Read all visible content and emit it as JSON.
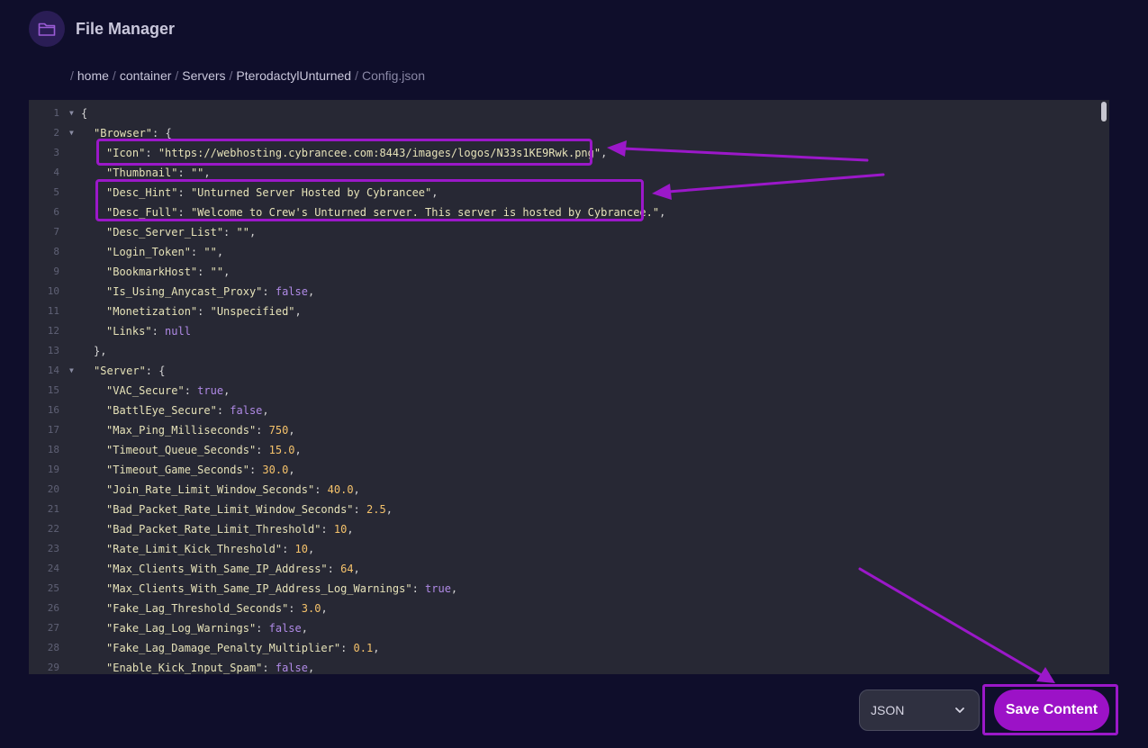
{
  "header": {
    "title": "File Manager",
    "icon": "folder-icon"
  },
  "breadcrumb": {
    "separator": "/",
    "items": [
      "home",
      "container",
      "Servers",
      "PterodactylUnturned"
    ],
    "current": "Config.json"
  },
  "editor": {
    "lines": [
      {
        "n": "1",
        "fold": true,
        "indent": 0,
        "tokens": [
          [
            "p",
            "{"
          ]
        ]
      },
      {
        "n": "2",
        "fold": true,
        "indent": 1,
        "tokens": [
          [
            "k",
            "\"Browser\""
          ],
          [
            "p",
            ": {"
          ]
        ]
      },
      {
        "n": "3",
        "fold": false,
        "indent": 2,
        "tokens": [
          [
            "k",
            "\"Icon\""
          ],
          [
            "p",
            ": "
          ],
          [
            "s",
            "\"https://webhosting.cybrancee.com:8443/images/logos/N33s1KE9Rwk.png\""
          ],
          [
            "p",
            ","
          ]
        ]
      },
      {
        "n": "4",
        "fold": false,
        "indent": 2,
        "tokens": [
          [
            "k",
            "\"Thumbnail\""
          ],
          [
            "p",
            ": "
          ],
          [
            "s",
            "\"\""
          ],
          [
            "p",
            ","
          ]
        ]
      },
      {
        "n": "5",
        "fold": false,
        "indent": 2,
        "tokens": [
          [
            "k",
            "\"Desc_Hint\""
          ],
          [
            "p",
            ": "
          ],
          [
            "s",
            "\"Unturned Server Hosted by Cybrancee\""
          ],
          [
            "p",
            ","
          ]
        ]
      },
      {
        "n": "6",
        "fold": false,
        "indent": 2,
        "tokens": [
          [
            "k",
            "\"Desc_Full\""
          ],
          [
            "p",
            ": "
          ],
          [
            "s",
            "\"Welcome to Crew's Unturned server. This server is hosted by Cybrancee.\""
          ],
          [
            "p",
            ","
          ]
        ]
      },
      {
        "n": "7",
        "fold": false,
        "indent": 2,
        "tokens": [
          [
            "k",
            "\"Desc_Server_List\""
          ],
          [
            "p",
            ": "
          ],
          [
            "s",
            "\"\""
          ],
          [
            "p",
            ","
          ]
        ]
      },
      {
        "n": "8",
        "fold": false,
        "indent": 2,
        "tokens": [
          [
            "k",
            "\"Login_Token\""
          ],
          [
            "p",
            ": "
          ],
          [
            "s",
            "\"\""
          ],
          [
            "p",
            ","
          ]
        ]
      },
      {
        "n": "9",
        "fold": false,
        "indent": 2,
        "tokens": [
          [
            "k",
            "\"BookmarkHost\""
          ],
          [
            "p",
            ": "
          ],
          [
            "s",
            "\"\""
          ],
          [
            "p",
            ","
          ]
        ]
      },
      {
        "n": "10",
        "fold": false,
        "indent": 2,
        "tokens": [
          [
            "k",
            "\"Is_Using_Anycast_Proxy\""
          ],
          [
            "p",
            ": "
          ],
          [
            "b",
            "false"
          ],
          [
            "p",
            ","
          ]
        ]
      },
      {
        "n": "11",
        "fold": false,
        "indent": 2,
        "tokens": [
          [
            "k",
            "\"Monetization\""
          ],
          [
            "p",
            ": "
          ],
          [
            "s",
            "\"Unspecified\""
          ],
          [
            "p",
            ","
          ]
        ]
      },
      {
        "n": "12",
        "fold": false,
        "indent": 2,
        "tokens": [
          [
            "k",
            "\"Links\""
          ],
          [
            "p",
            ": "
          ],
          [
            "b",
            "null"
          ]
        ]
      },
      {
        "n": "13",
        "fold": false,
        "indent": 1,
        "tokens": [
          [
            "p",
            "},"
          ]
        ]
      },
      {
        "n": "14",
        "fold": true,
        "indent": 1,
        "tokens": [
          [
            "k",
            "\"Server\""
          ],
          [
            "p",
            ": {"
          ]
        ]
      },
      {
        "n": "15",
        "fold": false,
        "indent": 2,
        "tokens": [
          [
            "k",
            "\"VAC_Secure\""
          ],
          [
            "p",
            ": "
          ],
          [
            "b",
            "true"
          ],
          [
            "p",
            ","
          ]
        ]
      },
      {
        "n": "16",
        "fold": false,
        "indent": 2,
        "tokens": [
          [
            "k",
            "\"BattlEye_Secure\""
          ],
          [
            "p",
            ": "
          ],
          [
            "b",
            "false"
          ],
          [
            "p",
            ","
          ]
        ]
      },
      {
        "n": "17",
        "fold": false,
        "indent": 2,
        "tokens": [
          [
            "k",
            "\"Max_Ping_Milliseconds\""
          ],
          [
            "p",
            ": "
          ],
          [
            "n",
            "750"
          ],
          [
            "p",
            ","
          ]
        ]
      },
      {
        "n": "18",
        "fold": false,
        "indent": 2,
        "tokens": [
          [
            "k",
            "\"Timeout_Queue_Seconds\""
          ],
          [
            "p",
            ": "
          ],
          [
            "n",
            "15.0"
          ],
          [
            "p",
            ","
          ]
        ]
      },
      {
        "n": "19",
        "fold": false,
        "indent": 2,
        "tokens": [
          [
            "k",
            "\"Timeout_Game_Seconds\""
          ],
          [
            "p",
            ": "
          ],
          [
            "n",
            "30.0"
          ],
          [
            "p",
            ","
          ]
        ]
      },
      {
        "n": "20",
        "fold": false,
        "indent": 2,
        "tokens": [
          [
            "k",
            "\"Join_Rate_Limit_Window_Seconds\""
          ],
          [
            "p",
            ": "
          ],
          [
            "n",
            "40.0"
          ],
          [
            "p",
            ","
          ]
        ]
      },
      {
        "n": "21",
        "fold": false,
        "indent": 2,
        "tokens": [
          [
            "k",
            "\"Bad_Packet_Rate_Limit_Window_Seconds\""
          ],
          [
            "p",
            ": "
          ],
          [
            "n",
            "2.5"
          ],
          [
            "p",
            ","
          ]
        ]
      },
      {
        "n": "22",
        "fold": false,
        "indent": 2,
        "tokens": [
          [
            "k",
            "\"Bad_Packet_Rate_Limit_Threshold\""
          ],
          [
            "p",
            ": "
          ],
          [
            "n",
            "10"
          ],
          [
            "p",
            ","
          ]
        ]
      },
      {
        "n": "23",
        "fold": false,
        "indent": 2,
        "tokens": [
          [
            "k",
            "\"Rate_Limit_Kick_Threshold\""
          ],
          [
            "p",
            ": "
          ],
          [
            "n",
            "10"
          ],
          [
            "p",
            ","
          ]
        ]
      },
      {
        "n": "24",
        "fold": false,
        "indent": 2,
        "tokens": [
          [
            "k",
            "\"Max_Clients_With_Same_IP_Address\""
          ],
          [
            "p",
            ": "
          ],
          [
            "n",
            "64"
          ],
          [
            "p",
            ","
          ]
        ]
      },
      {
        "n": "25",
        "fold": false,
        "indent": 2,
        "tokens": [
          [
            "k",
            "\"Max_Clients_With_Same_IP_Address_Log_Warnings\""
          ],
          [
            "p",
            ": "
          ],
          [
            "b",
            "true"
          ],
          [
            "p",
            ","
          ]
        ]
      },
      {
        "n": "26",
        "fold": false,
        "indent": 2,
        "tokens": [
          [
            "k",
            "\"Fake_Lag_Threshold_Seconds\""
          ],
          [
            "p",
            ": "
          ],
          [
            "n",
            "3.0"
          ],
          [
            "p",
            ","
          ]
        ]
      },
      {
        "n": "27",
        "fold": false,
        "indent": 2,
        "tokens": [
          [
            "k",
            "\"Fake_Lag_Log_Warnings\""
          ],
          [
            "p",
            ": "
          ],
          [
            "b",
            "false"
          ],
          [
            "p",
            ","
          ]
        ]
      },
      {
        "n": "28",
        "fold": false,
        "indent": 2,
        "tokens": [
          [
            "k",
            "\"Fake_Lag_Damage_Penalty_Multiplier\""
          ],
          [
            "p",
            ": "
          ],
          [
            "n",
            "0.1"
          ],
          [
            "p",
            ","
          ]
        ]
      },
      {
        "n": "29",
        "fold": false,
        "indent": 2,
        "tokens": [
          [
            "k",
            "\"Enable_Kick_Input_Spam\""
          ],
          [
            "p",
            ": "
          ],
          [
            "b",
            "false"
          ],
          [
            "p",
            ","
          ]
        ]
      }
    ]
  },
  "footer": {
    "format_select": {
      "value": "JSON",
      "icon": "chevron-down-icon"
    },
    "save_label": "Save Content"
  },
  "colors": {
    "accent": "#9c12c7",
    "annotation": "#9b18c9",
    "background": "#0f0e2b",
    "editor": "#272834"
  }
}
